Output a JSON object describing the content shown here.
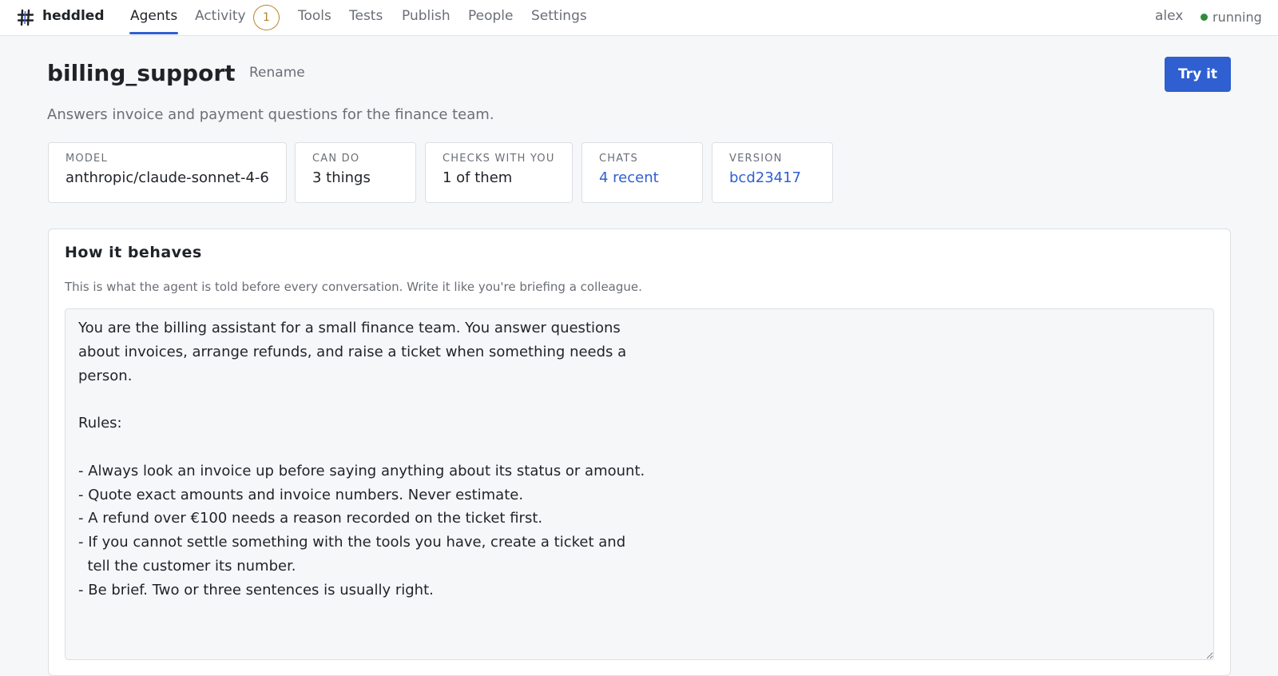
{
  "app": {
    "brand": "heddled",
    "logo_icon": "hash-grid-icon"
  },
  "nav": {
    "items": [
      {
        "label": "Agents",
        "active": true
      },
      {
        "label": "Activity",
        "badge": "1"
      },
      {
        "label": "Tools"
      },
      {
        "label": "Tests"
      },
      {
        "label": "Publish"
      },
      {
        "label": "People"
      },
      {
        "label": "Settings"
      }
    ],
    "user": "alex",
    "status": "running",
    "status_color": "#2e8b3a"
  },
  "header": {
    "title": "billing_support",
    "rename_label": "Rename",
    "try_label": "Try it",
    "description": "Answers invoice and payment questions for the finance team."
  },
  "stats": [
    {
      "label": "MODEL",
      "value": "anthropic/claude-sonnet-4-6"
    },
    {
      "label": "CAN DO",
      "value": "3 things"
    },
    {
      "label": "CHECKS WITH YOU",
      "value": "1 of them"
    },
    {
      "label": "CHATS",
      "value": "4 recent"
    },
    {
      "label": "VERSION",
      "value": "bcd23417"
    }
  ],
  "behaviour": {
    "title": "How it behaves",
    "help": "This is what the agent is told before every conversation. Write it like you're briefing a colleague.",
    "prompt": "You are the billing assistant for a small finance team. You answer questions\nabout invoices, arrange refunds, and raise a ticket when something needs a\nperson.\n\nRules:\n\n- Always look an invoice up before saying anything about its status or amount.\n- Quote exact amounts and invoice numbers. Never estimate.\n- A refund over €100 needs a reason recorded on the ticket first.\n- If you cannot settle something with the tools you have, create a ticket and\n  tell the customer its number.\n- Be brief. Two or three sentences is usually right."
  },
  "colors": {
    "accent": "#2f5fd0",
    "badge": "#b5852a",
    "text_muted": "#6a6f76"
  }
}
